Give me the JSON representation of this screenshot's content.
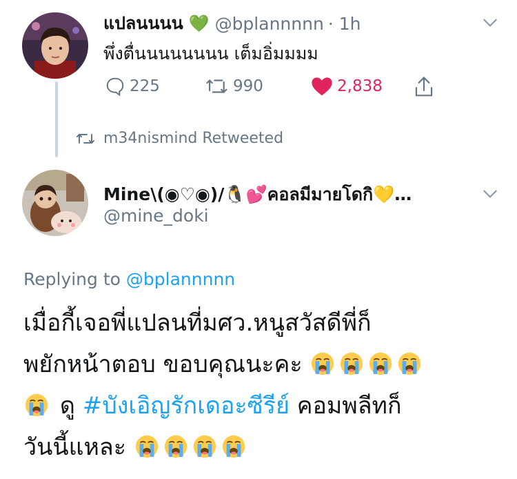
{
  "tweet1": {
    "author_name": "แปลนนนน",
    "heart_emoji": "💚",
    "handle": "@bplannnnn",
    "time": "· 1h",
    "text": "พึ่งตื่นนนนนนนน เต็มอิ่มมมม",
    "actions": {
      "replies": "225",
      "retweets": "990",
      "likes": "2,838"
    },
    "liked": true,
    "colors": {
      "like": "#e0245e",
      "muted": "#657786",
      "link": "#1da1f2"
    }
  },
  "retweet_label": "m34nismind Retweeted",
  "tweet2": {
    "author_name": "Mine\\(◉♡◉)/🐧💕คอลมีมายโดกิ💛…",
    "handle": "@mine_doki",
    "replying_prefix": "Replying to",
    "replying_handle": "@bplannnnn",
    "text_line1": "เมื่อกี้เจอพี่แปลนที่มศว.หนูสวัสดีพี่ก็",
    "text_line2": "พยักหน้าตอบ ขอบคุณนะคะ",
    "text_line3_a": "ดู",
    "hashtag": "#บังเอิญรักเดอะซีรีย์",
    "text_line3_b": "คอมพลีทก็",
    "text_line4": "วันนี้แหละ"
  },
  "icons": [
    "reply-icon",
    "retweet-icon",
    "heart-icon",
    "share-icon",
    "chevron-down-icon",
    "loudly-crying-face-emoji"
  ]
}
